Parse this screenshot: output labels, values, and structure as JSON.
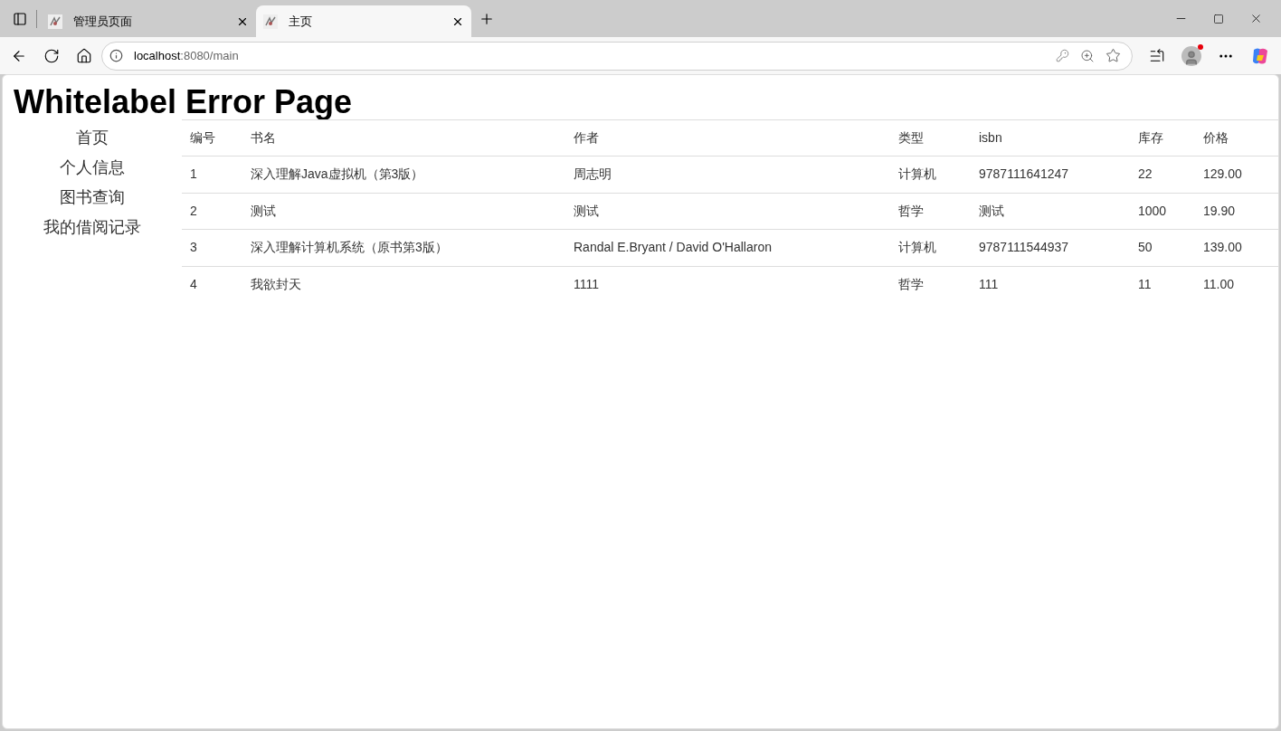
{
  "browser": {
    "tabs": [
      {
        "title": "管理员页面",
        "selected": false
      },
      {
        "title": "主页",
        "selected": true
      }
    ],
    "address": {
      "host": "localhost",
      "rest": ":8080/main"
    }
  },
  "page": {
    "heading": "Whitelabel Error Page",
    "nav": [
      "首页",
      "个人信息",
      "图书查询",
      "我的借阅记录"
    ],
    "table": {
      "columns": [
        "编号",
        "书名",
        "作者",
        "类型",
        "isbn",
        "库存",
        "价格"
      ],
      "rows": [
        [
          "1",
          "深入理解Java虚拟机（第3版）",
          "周志明",
          "计算机",
          "9787111641247",
          "22",
          "129.00"
        ],
        [
          "2",
          "测试",
          "测试",
          "哲学",
          "测试",
          "1000",
          "19.90"
        ],
        [
          "3",
          "深入理解计算机系统（原书第3版）",
          "Randal E.Bryant / David O'Hallaron",
          "计算机",
          "9787111544937",
          "50",
          "139.00"
        ],
        [
          "4",
          "我欲封天",
          "1111",
          "哲学",
          "111",
          "11",
          "11.00"
        ]
      ]
    }
  }
}
